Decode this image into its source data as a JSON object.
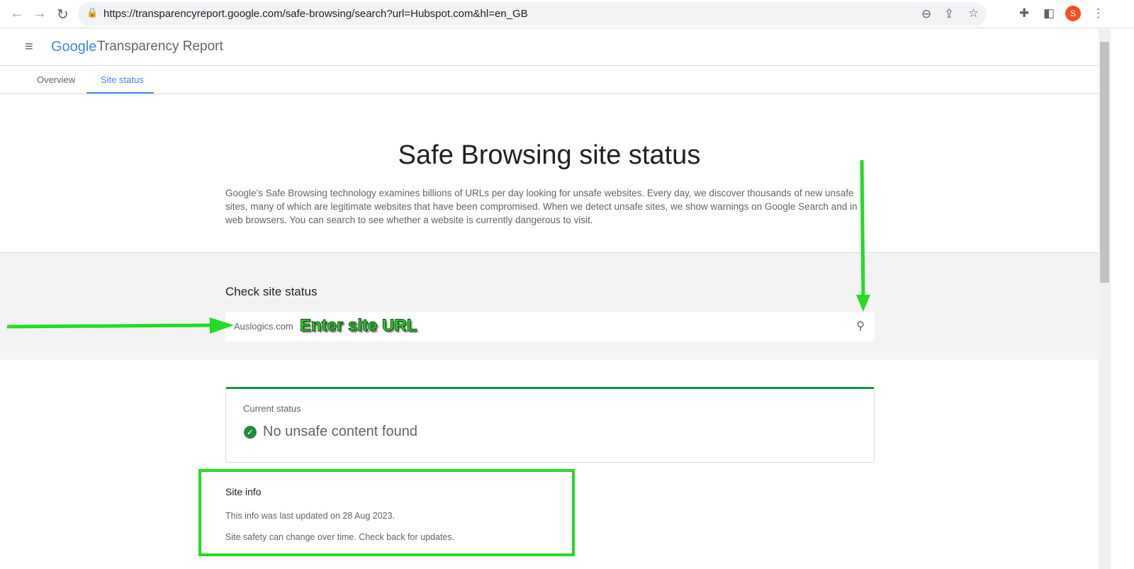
{
  "browser": {
    "url": "https://transparencyreport.google.com/safe-browsing/search?url=Hubspot.com&hl=en_GB",
    "profile_initial": "S"
  },
  "header": {
    "logo": "Google",
    "title": "Transparency Report"
  },
  "tabs": [
    {
      "label": "Overview"
    },
    {
      "label": "Site status",
      "active": true
    }
  ],
  "hero": {
    "title": "Safe Browsing site status",
    "description": "Google’s Safe Browsing technology examines billions of URLs per day looking for unsafe websites. Every day, we discover thousands of new unsafe sites, many of which are legitimate websites that have been compromised. When we detect unsafe sites, we show warnings on Google Search and in web browsers. You can search to see whether a website is currently dangerous to visit."
  },
  "check": {
    "heading": "Check site status",
    "value": "Auslogics.com"
  },
  "annotation": {
    "label": "Enter site URL",
    "color": "#22dd22"
  },
  "status": {
    "label": "Current status",
    "value": "No unsafe content found",
    "color": "#1e8e3e"
  },
  "site_info": {
    "heading": "Site info",
    "updated": "This info was last updated on 28 Aug 2023.",
    "note": "Site safety can change over time. Check back for updates."
  }
}
